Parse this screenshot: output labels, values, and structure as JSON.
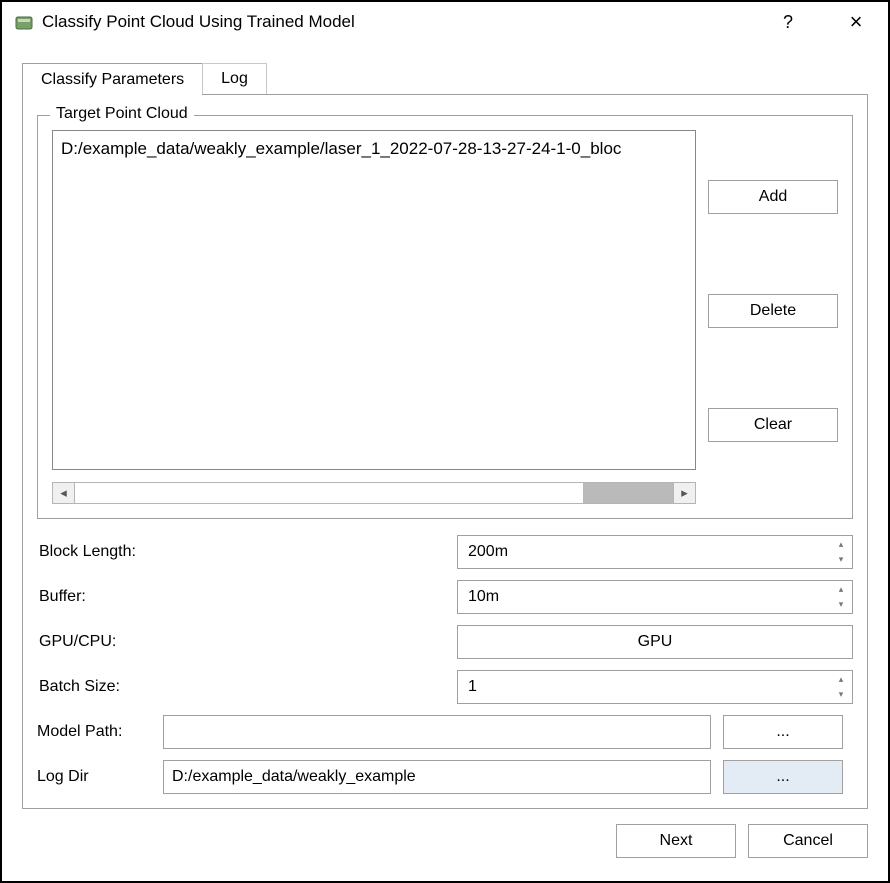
{
  "window": {
    "title": "Classify Point Cloud Using Trained Model",
    "help_symbol": "?",
    "close_symbol": "×"
  },
  "tabs": [
    {
      "id": "params",
      "label": "Classify Parameters",
      "active": true
    },
    {
      "id": "log",
      "label": "Log",
      "active": false
    }
  ],
  "target": {
    "legend": "Target Point Cloud",
    "items": [
      "D:/example_data/weakly_example/laser_1_2022-07-28-13-27-24-1-0_bloc"
    ],
    "buttons": {
      "add": "Add",
      "del": "Delete",
      "clear": "Clear"
    }
  },
  "params": {
    "block_length": {
      "label": "Block Length:",
      "value": "200m"
    },
    "buffer": {
      "label": "Buffer:",
      "value": "10m"
    },
    "gpu_cpu": {
      "label": "GPU/CPU:",
      "value": "GPU"
    },
    "batch_size": {
      "label": "Batch Size:",
      "value": "1"
    }
  },
  "paths": {
    "model": {
      "label": "Model Path:",
      "value": ""
    },
    "logdir": {
      "label": "Log Dir",
      "value": "D:/example_data/weakly_example"
    },
    "browse_symbol": "..."
  },
  "footer": {
    "next": "Next",
    "cancel": "Cancel"
  }
}
